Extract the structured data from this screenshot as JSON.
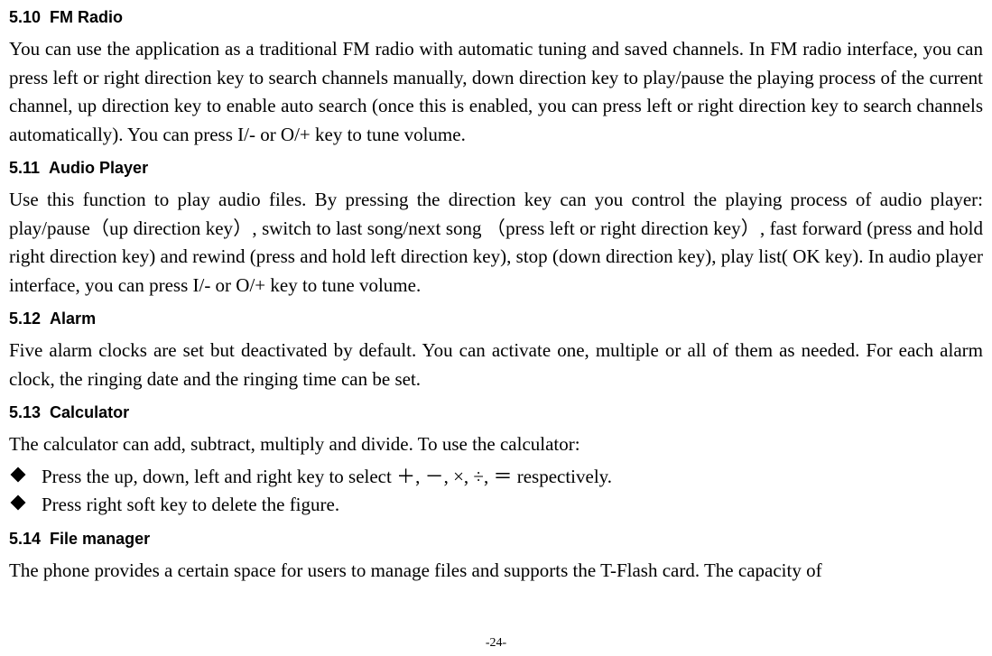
{
  "sections": {
    "s510": {
      "num": "5.10",
      "title": "FM Radio",
      "para": "You can use the application as a traditional FM radio with automatic tuning and saved channels. In FM radio interface, you can press left or right direction key to search channels manually, down direction key to play/pause the playing process of the current channel, up direction key to enable auto search (once this is enabled, you can press left or right direction key to search channels automatically). You can press I/- or O/+ key to tune volume."
    },
    "s511": {
      "num": "5.11",
      "title": "Audio Player",
      "para": "Use this function to play audio files. By pressing the direction key can you control the playing process of audio player: play/pause（up direction key）, switch to last song/next song （press left or right direction key）, fast forward (press and hold right direction key) and rewind (press and hold left direction key), stop (down direction key), play list( OK key). In audio player interface, you can press I/- or O/+ key to tune volume."
    },
    "s512": {
      "num": "5.12",
      "title": "Alarm",
      "para": "Five alarm clocks are set but deactivated by default. You can activate one, multiple or all of them as needed. For each alarm clock, the ringing date and the ringing time can be set."
    },
    "s513": {
      "num": "5.13",
      "title": "Calculator",
      "para": "The calculator can add, subtract, multiply and divide. To use the calculator:",
      "bullets": [
        "Press the up, down, left and right key to select ＋, －, ×, ÷, ＝ respectively.",
        "Press right soft key to delete the figure."
      ]
    },
    "s514": {
      "num": "5.14",
      "title": "File manager",
      "para": "The phone provides a certain space for users to manage files and supports the T-Flash card. The capacity of"
    }
  },
  "page_number": "-24-"
}
